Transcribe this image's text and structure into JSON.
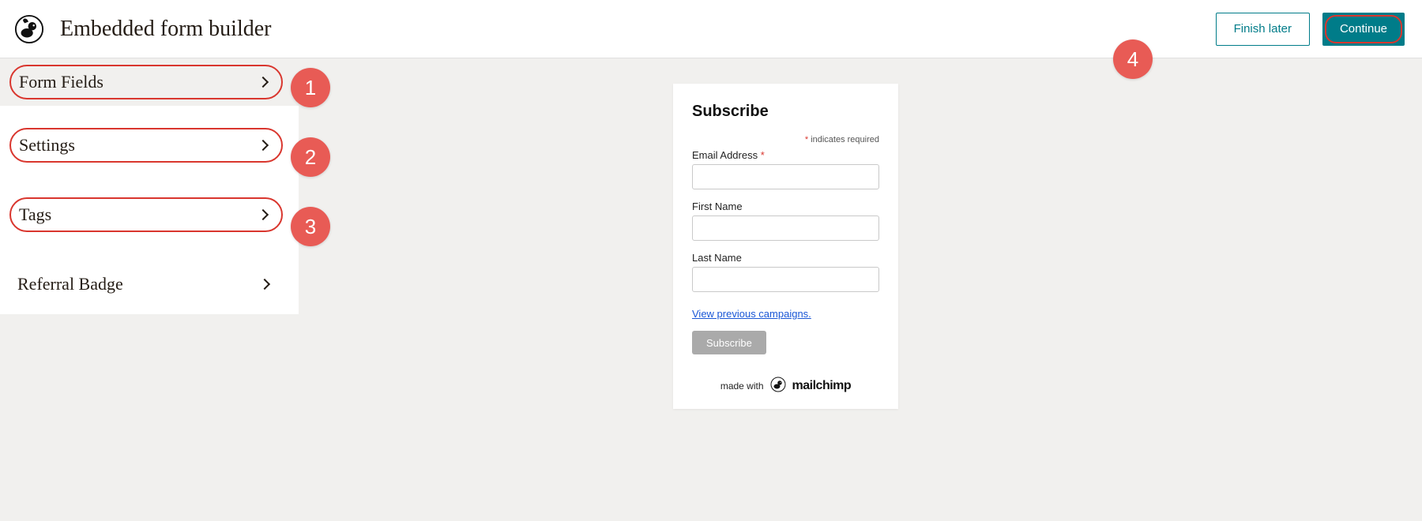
{
  "header": {
    "title": "Embedded form builder",
    "finish_later_label": "Finish later",
    "continue_label": "Continue"
  },
  "sidebar": {
    "items": [
      {
        "label": "Form Fields",
        "active": true,
        "highlighted": true
      },
      {
        "label": "Settings",
        "active": false,
        "highlighted": true
      },
      {
        "label": "Tags",
        "active": false,
        "highlighted": true
      },
      {
        "label": "Referral Badge",
        "active": false,
        "highlighted": false
      }
    ]
  },
  "annotations": {
    "badge1": "1",
    "badge2": "2",
    "badge3": "3",
    "badge4": "4"
  },
  "preview": {
    "heading": "Subscribe",
    "required_note": "indicates required",
    "fields": [
      {
        "label": "Email Address",
        "required": true
      },
      {
        "label": "First Name",
        "required": false
      },
      {
        "label": "Last Name",
        "required": false
      }
    ],
    "previous_link": "View previous campaigns.",
    "subscribe_label": "Subscribe",
    "made_with": "made with",
    "brand": "mailchimp"
  }
}
